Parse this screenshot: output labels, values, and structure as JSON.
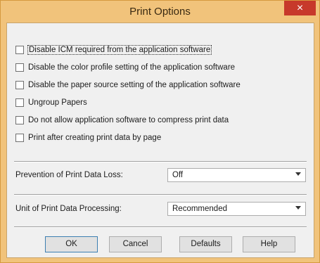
{
  "window": {
    "title": "Print Options",
    "close_symbol": "×"
  },
  "checkboxes": [
    {
      "label": "Disable ICM required from the application software",
      "checked": false
    },
    {
      "label": "Disable the color profile setting of the application software",
      "checked": false
    },
    {
      "label": "Disable the paper source setting of the application software",
      "checked": false
    },
    {
      "label": "Ungroup Papers",
      "checked": false
    },
    {
      "label": "Do not allow application software to compress print data",
      "checked": false
    },
    {
      "label": "Print after creating print data by page",
      "checked": false
    }
  ],
  "prevention": {
    "label": "Prevention of Print Data Loss:",
    "value": "Off"
  },
  "unit": {
    "label": "Unit of Print Data Processing:",
    "value": "Recommended"
  },
  "buttons": {
    "ok": "OK",
    "cancel": "Cancel",
    "defaults": "Defaults",
    "help": "Help"
  }
}
